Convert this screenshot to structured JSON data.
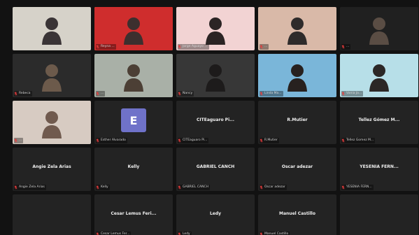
{
  "meeting": {
    "tiles": [
      {
        "label": "",
        "center": "",
        "kind": "video",
        "bg": "#d6d2c9",
        "person": "#3a3436"
      },
      {
        "label": "Reyna ...",
        "center": "",
        "kind": "video",
        "bg": "#cf2d2d",
        "person": "#3d2f2e",
        "active": true
      },
      {
        "label": "Jorge Aguayo ...",
        "center": "",
        "kind": "video",
        "bg": "#f2d3d3",
        "person": "#2b2424"
      },
      {
        "label": "...",
        "center": "",
        "kind": "video",
        "bg": "#d9b9a8",
        "person": "#2e2b2b"
      },
      {
        "label": "...",
        "center": "",
        "kind": "video",
        "bg": "#202020",
        "person": "#5a4d44"
      },
      {
        "label": "Rebeca",
        "center": "",
        "kind": "video",
        "bg": "#2b2b2b",
        "person": "#6c5a4b"
      },
      {
        "label": "...",
        "center": "",
        "kind": "video",
        "bg": "#a9b0a7",
        "person": "#4c3f35"
      },
      {
        "label": "Nancy",
        "center": "",
        "kind": "video",
        "bg": "#373737",
        "person": "#1d1b1b"
      },
      {
        "label": "Linda Ma...",
        "center": "",
        "kind": "video",
        "bg": "#7ab6d9",
        "person": "#27211f"
      },
      {
        "label": "Vania Ja...",
        "center": "",
        "kind": "video",
        "bg": "#b7dfe8",
        "person": "#2b2726"
      },
      {
        "label": "...",
        "center": "",
        "kind": "video",
        "bg": "#d7cbc2",
        "person": "#705a4e"
      },
      {
        "label": "Esther Alvarado",
        "center": "",
        "kind": "avatar",
        "initial": "E"
      },
      {
        "label": "CITEaguaro Pi...",
        "center": "CITEaguaro Pi...",
        "kind": "name"
      },
      {
        "label": "R.Mutier",
        "center": "R.Mutier",
        "kind": "name"
      },
      {
        "label": "Tellez Gomez M...",
        "center": "Tellez Gómez M...",
        "kind": "name"
      },
      {
        "label": "Angie Zela Arias",
        "center": "Angie Zela Arias",
        "kind": "name"
      },
      {
        "label": "Kelly",
        "center": "Kelly",
        "kind": "name"
      },
      {
        "label": "GABRIEL CANCH",
        "center": "GABRIEL CANCH",
        "kind": "name"
      },
      {
        "label": "Oscar adezar",
        "center": "Oscar adezar",
        "kind": "name"
      },
      {
        "label": "YESENIA FERN...",
        "center": "YESENIA FERN...",
        "kind": "name"
      },
      {
        "label": "",
        "center": "",
        "kind": "blank"
      },
      {
        "label": "Cesar Lemus Fer...",
        "center": "Cesar Lemus Feri...",
        "kind": "name"
      },
      {
        "label": "Ledy",
        "center": "Ledy",
        "kind": "name"
      },
      {
        "label": "Manuel Castillo",
        "center": "Manuel Castillo",
        "kind": "name"
      },
      {
        "label": "",
        "center": "",
        "kind": "blank"
      }
    ]
  }
}
